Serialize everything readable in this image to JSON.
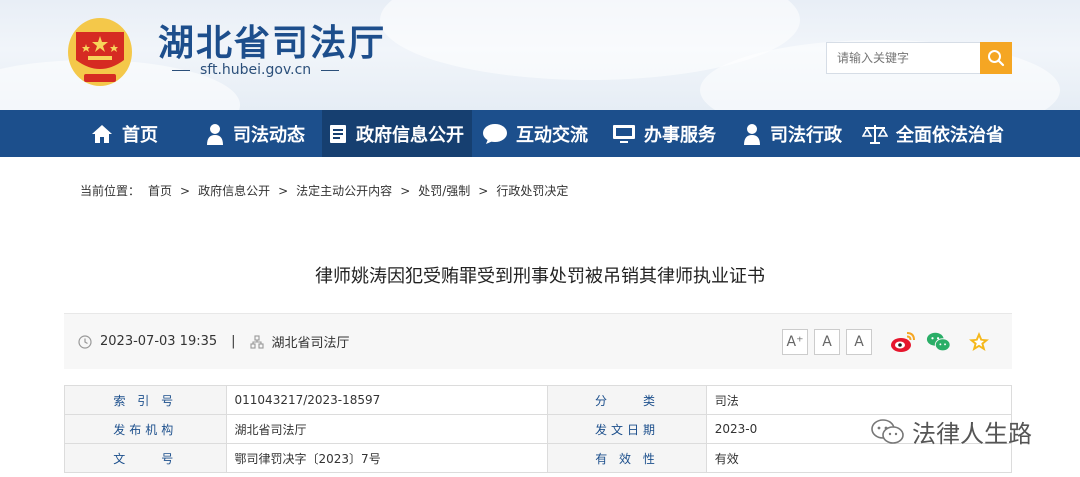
{
  "header": {
    "site_title": "湖北省司法厅",
    "domain": "sft.hubei.gov.cn",
    "search": {
      "placeholder": "请输入关键字"
    }
  },
  "nav": {
    "items": [
      {
        "label": "首页",
        "icon": "home-icon"
      },
      {
        "label": "司法动态",
        "icon": "person-icon"
      },
      {
        "label": "政府信息公开",
        "icon": "document-icon"
      },
      {
        "label": "互动交流",
        "icon": "chat-icon"
      },
      {
        "label": "办事服务",
        "icon": "monitor-icon"
      },
      {
        "label": "司法行政",
        "icon": "person-icon"
      },
      {
        "label": "全面依法治省",
        "icon": "scales-icon"
      }
    ]
  },
  "breadcrumb": {
    "prefix": "当前位置：",
    "items": [
      "首页",
      "政府信息公开",
      "法定主动公开内容",
      "处罚/强制",
      "行政处罚决定"
    ]
  },
  "article": {
    "title": "律师姚涛因犯受贿罪受到刑事处罚被吊销其律师执业证书",
    "date": "2023-07-03 19:35",
    "separator": "|",
    "source": "湖北省司法厅",
    "font_sizes": [
      "A⁺",
      "A",
      "A"
    ]
  },
  "info_table": [
    {
      "label1": "索 引 号",
      "value1": "011043217/2023-18597",
      "label2": "分　　类",
      "value2": "司法"
    },
    {
      "label1": "发布机构",
      "value1": "湖北省司法厅",
      "label2": "发文日期",
      "value2": "2023-0"
    },
    {
      "label1": "文　　号",
      "value1": "鄂司律罚决字〔2023〕7号",
      "label2": "有 效 性",
      "value2": "有效"
    }
  ],
  "watermark": {
    "text": "法律人生路"
  },
  "colors": {
    "nav_bg": "#1c4f8c",
    "accent": "#f5a623",
    "label": "#1c4f8c"
  }
}
